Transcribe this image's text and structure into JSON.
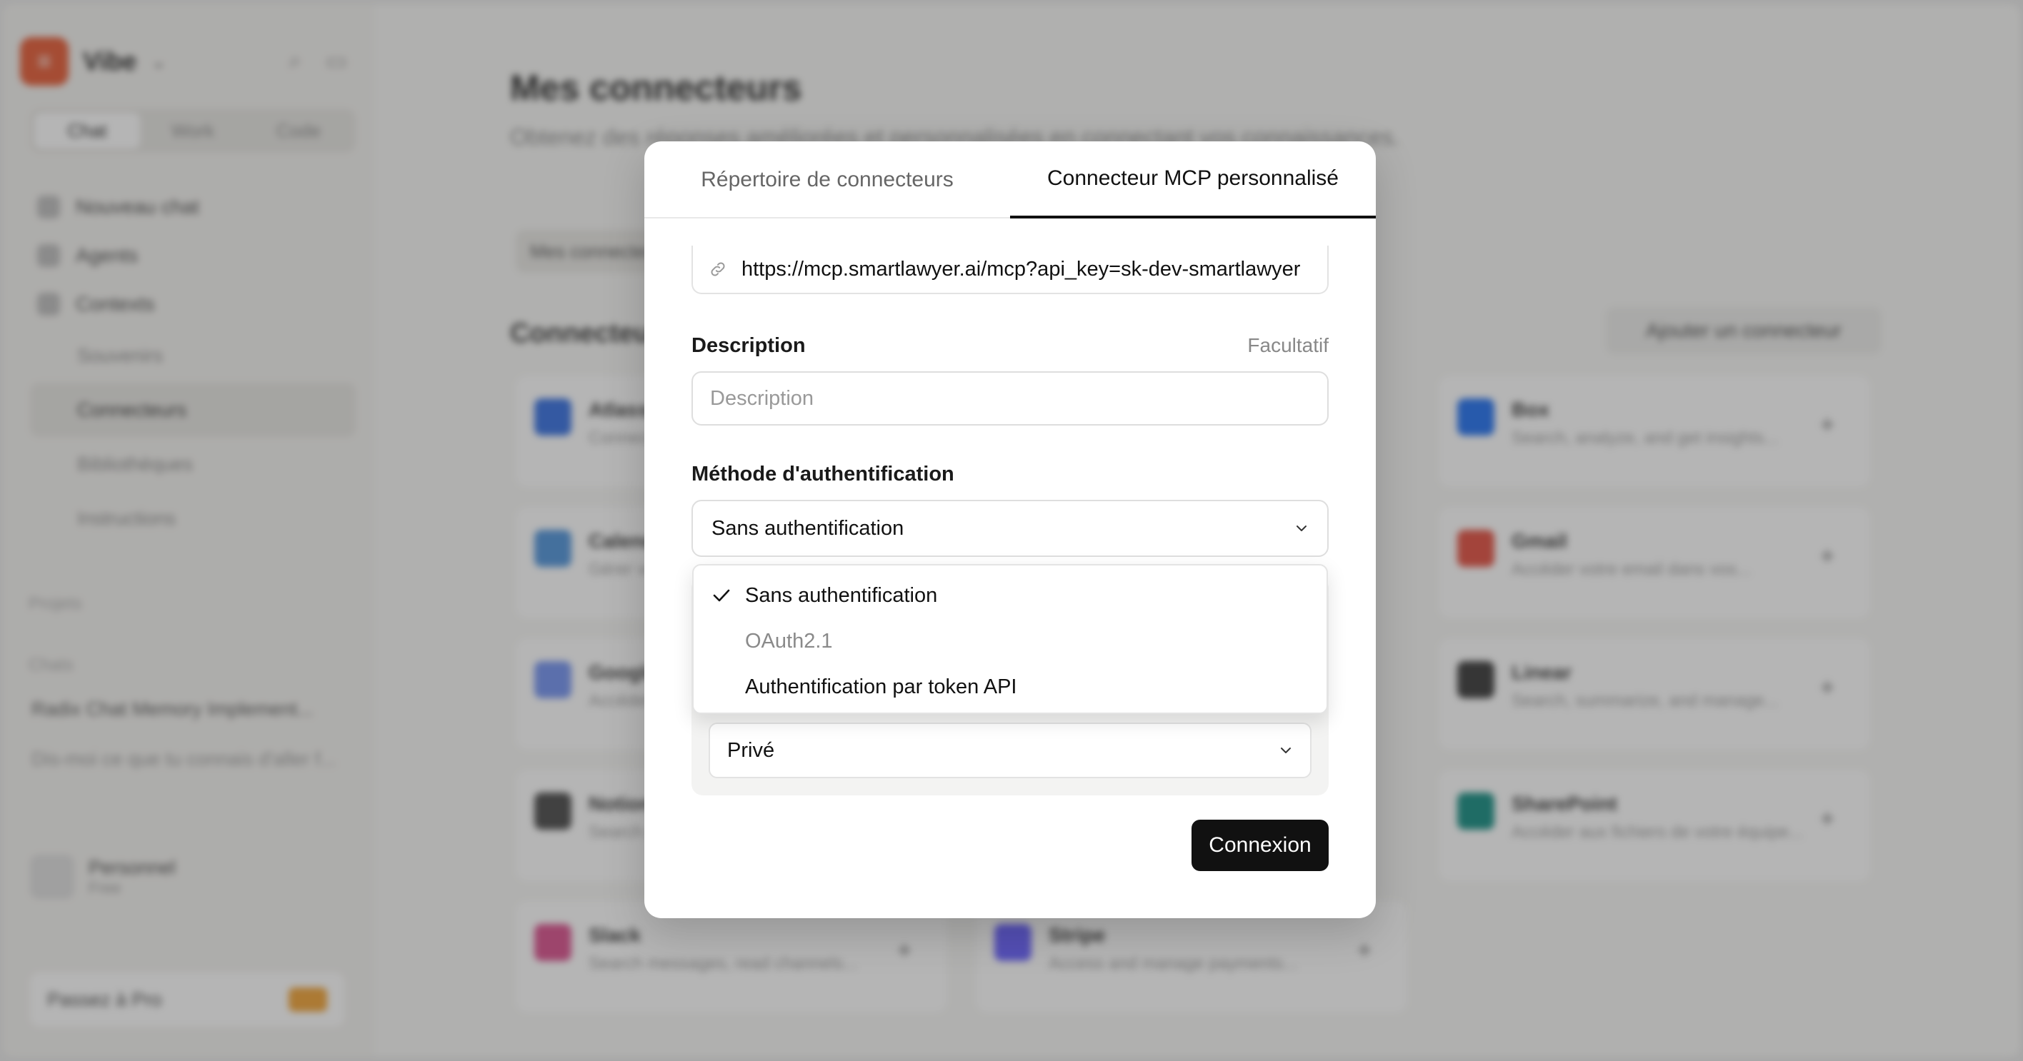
{
  "background": {
    "brand": {
      "name": "Vibe"
    },
    "mode_tabs": [
      "Chat",
      "Work",
      "Code"
    ],
    "nav": [
      "Nouveau chat",
      "Agents",
      "Contexts"
    ],
    "nav_sub": [
      "Souvenirs",
      "Connecteurs",
      "Bibliothèques",
      "Instructions"
    ],
    "projects_label": "Projets",
    "chats_label": "Chats",
    "chats": [
      "Radix Chat Memory Implement...",
      "Dis-moi ce que tu connais d'aller f..."
    ],
    "user": {
      "name": "Personnel",
      "plan": "Free"
    },
    "upgrade": "Passez à Pro",
    "page_title": "Mes connecteurs",
    "page_subtitle": "Obtenez des réponses améliorées et personnalisées en connectant vos connaissances.",
    "pill": "Mes connecteurs",
    "section_title": "Connecteurs",
    "add_button": "Ajouter un connecteur",
    "cards": [
      {
        "title": "Atlassian",
        "desc": "Connect to Jira and Confluence..."
      },
      {
        "title": "Box",
        "desc": "Search, analyze, and get insights..."
      },
      {
        "title": "Calendar",
        "desc": "Gérer vos événements..."
      },
      {
        "title": "Gmail",
        "desc": "Accéder votre email dans vos..."
      },
      {
        "title": "Google Drive",
        "desc": "Accéder aux fichiers..."
      },
      {
        "title": "Linear",
        "desc": "Search, summarize, and manage..."
      },
      {
        "title": "Notion",
        "desc": "Search pages and databases..."
      },
      {
        "title": "SharePoint",
        "desc": "Accéder aux fichiers de votre équipe..."
      },
      {
        "title": "Slack",
        "desc": "Search messages, read channels..."
      },
      {
        "title": "Stripe",
        "desc": "Access and manage payments..."
      }
    ]
  },
  "modal": {
    "tabs": [
      "Répertoire de connecteurs",
      "Connecteur MCP personnalisé"
    ],
    "active_tab": 1,
    "url_value": "https://mcp.smartlawyer.ai/mcp?api_key=sk-dev-smartlawyer",
    "description": {
      "label": "Description",
      "optional": "Facultatif",
      "placeholder": "Description",
      "value": ""
    },
    "auth": {
      "label": "Méthode d'authentification",
      "selected": "Sans authentification",
      "options": [
        {
          "label": "Sans authentification",
          "checked": true,
          "disabled": false
        },
        {
          "label": "OAuth2.1",
          "checked": false,
          "disabled": true
        },
        {
          "label": "Authentification par token API",
          "checked": false,
          "disabled": false
        }
      ]
    },
    "visibility": {
      "selected": "Privé"
    },
    "submit": "Connexion"
  },
  "colors": {
    "brand": "#e5562f",
    "primary_button": "#111111",
    "overlay": "rgba(60,60,60,0.38)"
  }
}
